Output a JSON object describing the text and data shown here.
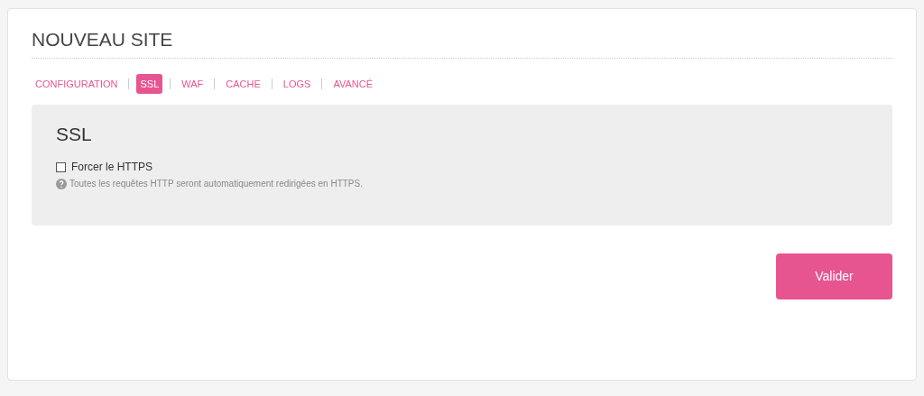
{
  "title": "NOUVEAU SITE",
  "tabs": [
    {
      "label": "CONFIGURATION",
      "selected": false
    },
    {
      "label": "SSL",
      "selected": true
    },
    {
      "label": "WAF",
      "selected": false
    },
    {
      "label": "CACHE",
      "selected": false
    },
    {
      "label": "LOGS",
      "selected": false
    },
    {
      "label": "AVANCÉ",
      "selected": false
    }
  ],
  "panel": {
    "heading": "SSL",
    "option": {
      "label": "Forcer le HTTPS",
      "checked": false
    },
    "help": "Toutes les requêtes HTTP seront automatiquement redirigées en HTTPS."
  },
  "submit": "Valider"
}
